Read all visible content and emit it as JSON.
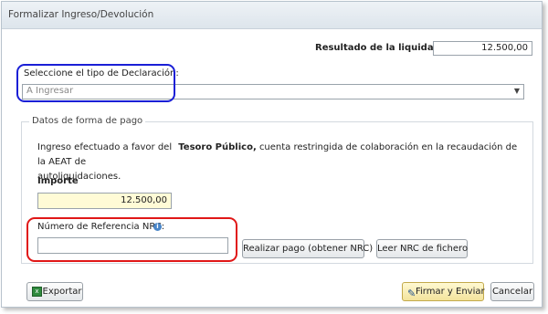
{
  "dialog": {
    "title": "Formalizar Ingreso/Devolución"
  },
  "liquidacion": {
    "label": "Resultado de la liquidación",
    "value": "12.500,00"
  },
  "declaracion": {
    "label": "Seleccione el tipo de Declaración:",
    "selected": "A Ingresar"
  },
  "pago": {
    "legend": "Datos de forma de pago",
    "text_before": "Ingreso efectuado a favor del",
    "text_bold": "Tesoro Público,",
    "text_after": "cuenta restringida de colaboración en la recaudación de la AEAT de",
    "text_line2": "autoliquidaciones.",
    "importe_label": "Importe",
    "importe_value": "12.500,00",
    "nrc_label": "Número de Referencia  NRC:",
    "nrc_value": "",
    "realizar_button": "Realizar pago (obtener NRC)",
    "leer_button": "Leer NRC de fichero"
  },
  "footer": {
    "exportar_button": "Exportar",
    "firmar_button": "Firmar y Enviar",
    "cancelar_button": "Cancelar"
  }
}
